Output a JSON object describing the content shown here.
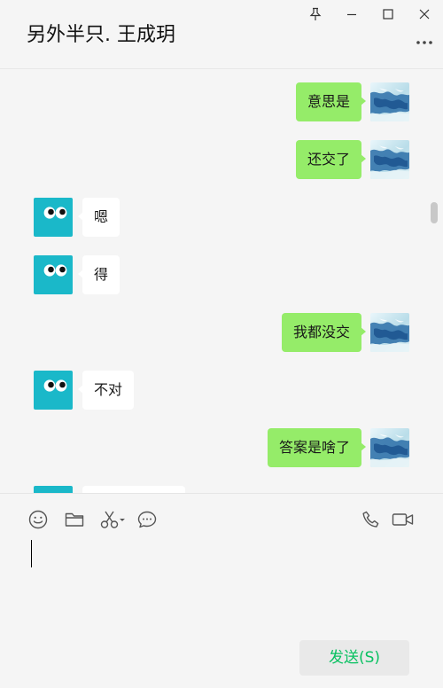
{
  "header": {
    "title": "另外半只. 王成玥",
    "window_controls": [
      "pin-icon",
      "minimize-icon",
      "maximize-icon",
      "close-icon"
    ],
    "more_icon": "more-icon"
  },
  "messages": [
    {
      "sender": "me",
      "text": "意思是"
    },
    {
      "sender": "me",
      "text": "还交了"
    },
    {
      "sender": "other",
      "text": "嗯"
    },
    {
      "sender": "other",
      "text": "得"
    },
    {
      "sender": "me",
      "text": "我都没交"
    },
    {
      "sender": "other",
      "text": "不对"
    },
    {
      "sender": "me",
      "text": "答案是啥了"
    },
    {
      "sender": "other",
      "text": ""
    }
  ],
  "toolbar": {
    "left_icons": [
      "emoji-icon",
      "folder-icon",
      "scissors-icon",
      "chat-bubble-icon"
    ],
    "right_icons": [
      "phone-icon",
      "video-icon"
    ]
  },
  "input": {
    "value": ""
  },
  "send_button": {
    "label": "发送(S)"
  },
  "colors": {
    "my_bubble": "#95ec69",
    "other_bubble": "#ffffff",
    "send_text": "#07c160",
    "other_avatar": "#1ab8c9"
  }
}
